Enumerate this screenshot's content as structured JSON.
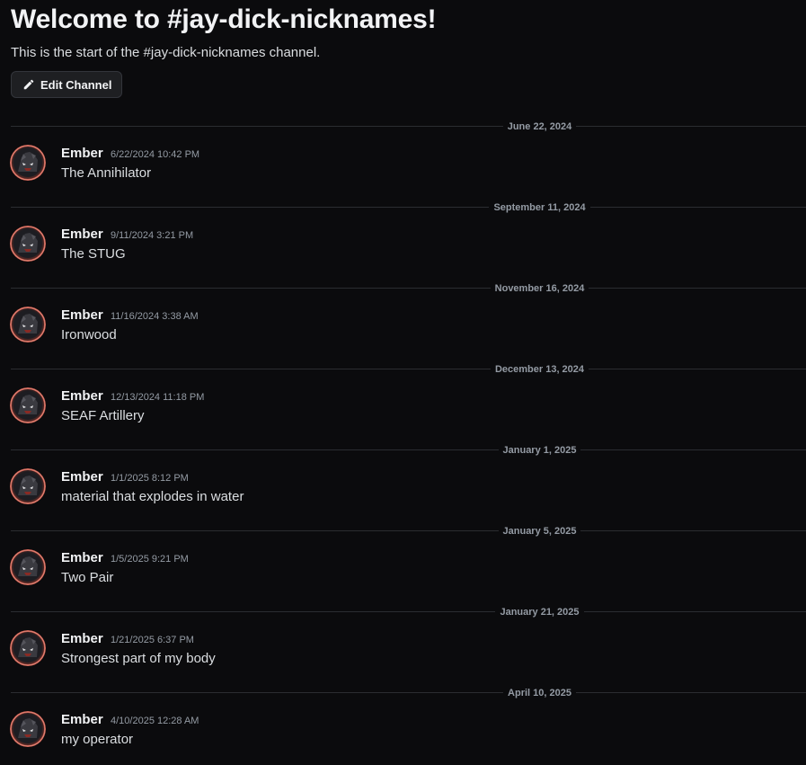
{
  "header": {
    "title": "Welcome to #jay-dick-nicknames!",
    "subtitle": "This is the start of the #jay-dick-nicknames channel.",
    "edit_button_label": "Edit Channel",
    "edit_button_icon": "pencil-icon"
  },
  "messages": [
    {
      "date": "June 22, 2024",
      "author": "Ember",
      "timestamp": "6/22/2024 10:42 PM",
      "content": "The Annihilator"
    },
    {
      "date": "September 11, 2024",
      "author": "Ember",
      "timestamp": "9/11/2024 3:21 PM",
      "content": "The STUG"
    },
    {
      "date": "November 16, 2024",
      "author": "Ember",
      "timestamp": "11/16/2024 3:38 AM",
      "content": "Ironwood"
    },
    {
      "date": "December 13, 2024",
      "author": "Ember",
      "timestamp": "12/13/2024 11:18 PM",
      "content": "SEAF Artillery"
    },
    {
      "date": "January 1, 2025",
      "author": "Ember",
      "timestamp": "1/1/2025 8:12 PM",
      "content": "material that explodes in water"
    },
    {
      "date": "January 5, 2025",
      "author": "Ember",
      "timestamp": "1/5/2025 9:21 PM",
      "content": "Two Pair"
    },
    {
      "date": "January 21, 2025",
      "author": "Ember",
      "timestamp": "1/21/2025 6:37 PM",
      "content": "Strongest part of my body"
    },
    {
      "date": "April 10, 2025",
      "author": "Ember",
      "timestamp": "4/10/2025 12:28 AM",
      "content": "my operator"
    }
  ],
  "colors": {
    "background": "#0b0b0d",
    "divider": "#2b2d31",
    "muted_text": "#949ba4",
    "primary_text": "#f2f3f5",
    "avatar_ring": "#e07a66"
  }
}
